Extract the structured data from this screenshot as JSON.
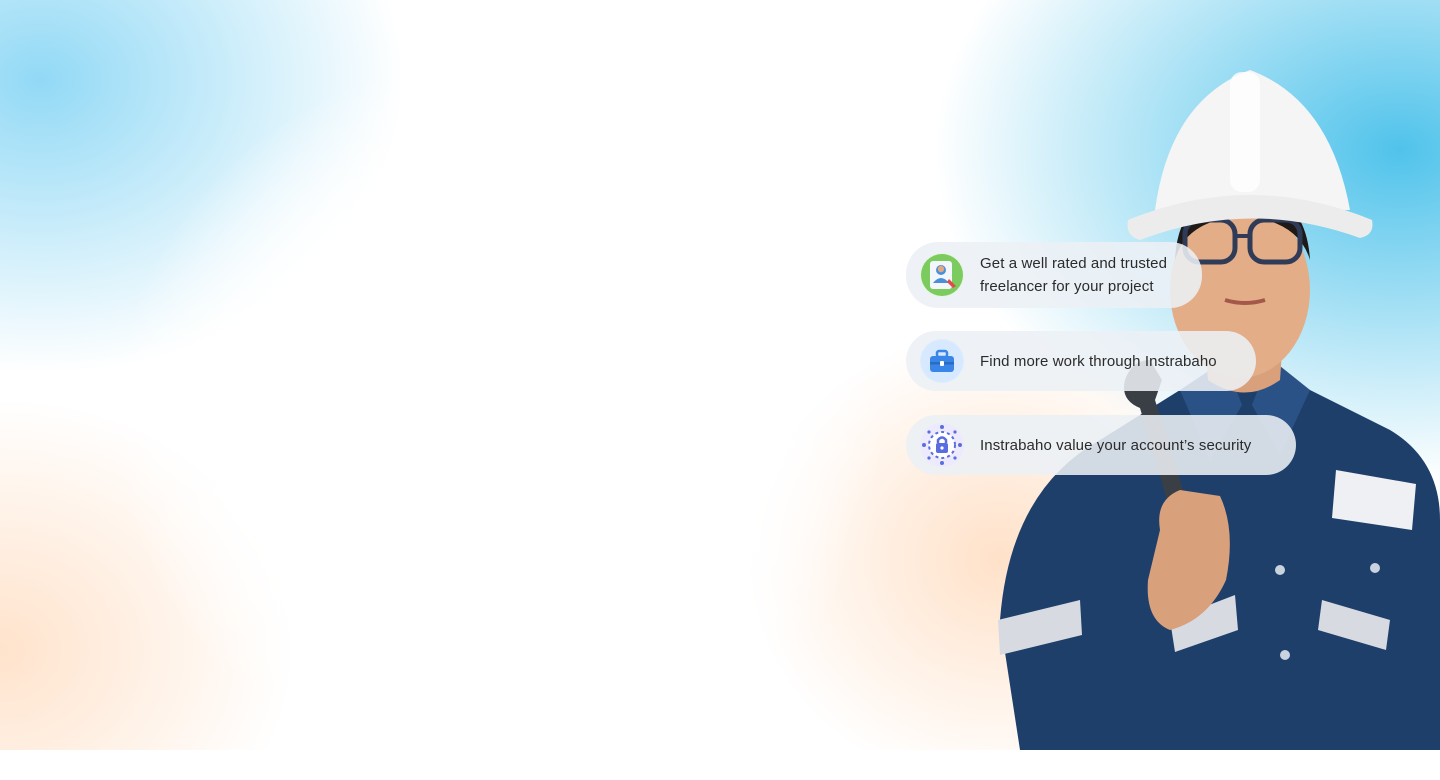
{
  "features": [
    {
      "icon": "freelancer-profile-icon",
      "text": "Get a well rated and trusted\nfreelancer for your project"
    },
    {
      "icon": "briefcase-icon",
      "text": "Find more work through Instrabaho"
    },
    {
      "icon": "security-lock-icon",
      "text": "Instrabaho value your account’s security"
    }
  ],
  "colors": {
    "sky_blue": "#5ac3eb",
    "peach": "#ffdec3",
    "pill_bg": "#ecf0f5",
    "text": "#2b2b2b",
    "shirt_navy": "#1f3f6b",
    "helmet_white": "#f5f5f5"
  },
  "hero_image": "construction-worker-with-wrench"
}
